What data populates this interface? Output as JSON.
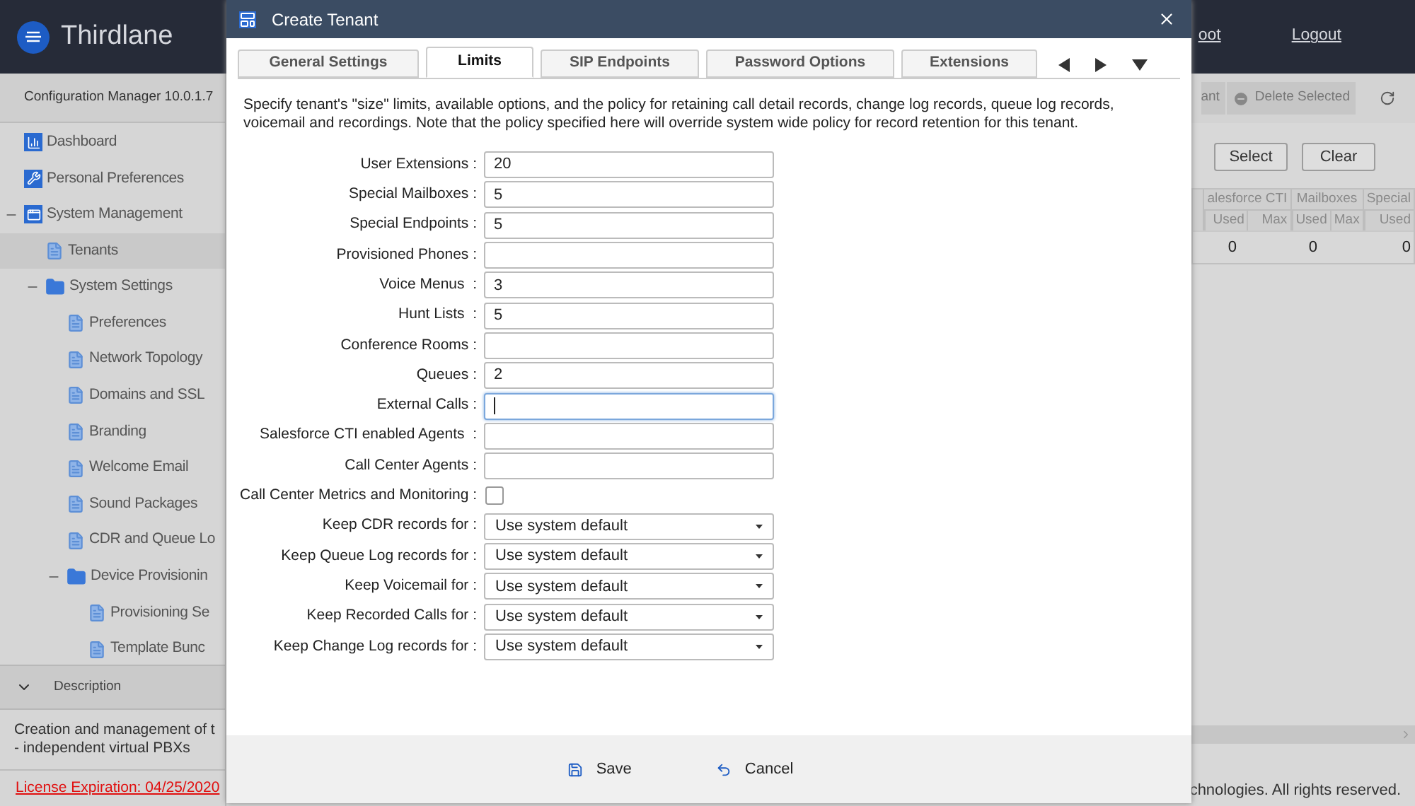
{
  "app": {
    "logo_text": "Thirdlane",
    "header_links": [
      {
        "label": "oot"
      },
      {
        "label": "Logout"
      }
    ],
    "version": "Configuration Manager 10.0.1.7"
  },
  "toolbar": {
    "buttons": [
      {
        "label": "ant",
        "kind": "plain",
        "disabled": true
      },
      {
        "label": "Delete Selected",
        "kind": "delete",
        "disabled": true
      }
    ]
  },
  "sidebar": {
    "items": [
      {
        "label": "Dashboard",
        "kind": "dashboard",
        "selected": false
      },
      {
        "label": "Personal Preferences",
        "kind": "wrench",
        "selected": false
      },
      {
        "label": "System Management",
        "kind": "section",
        "selected": false,
        "expanded": true,
        "children": [
          {
            "label": "Tenants",
            "kind": "page",
            "selected": true
          },
          {
            "label": "System Settings",
            "kind": "folder",
            "selected": false,
            "expanded": true,
            "children": [
              {
                "label": "Preferences",
                "kind": "page",
                "selected": false
              },
              {
                "label": "Network Topology",
                "kind": "page",
                "selected": false
              },
              {
                "label": "Domains and SSL",
                "kind": "page",
                "selected": false
              },
              {
                "label": "Branding",
                "kind": "page",
                "selected": false
              },
              {
                "label": "Welcome Email",
                "kind": "page",
                "selected": false
              },
              {
                "label": "Sound Packages",
                "kind": "page",
                "selected": false
              },
              {
                "label": "CDR and Queue Lo",
                "kind": "page",
                "selected": false
              },
              {
                "label": "Device Provisionin",
                "kind": "folder",
                "selected": false,
                "expanded": true,
                "children": [
                  {
                    "label": "Provisioning Se",
                    "kind": "page",
                    "selected": false
                  },
                  {
                    "label": "Template Bunc",
                    "kind": "page",
                    "selected": false
                  }
                ]
              }
            ]
          }
        ]
      }
    ]
  },
  "description": {
    "title": "Description",
    "expanded": true,
    "text": "Creation and management of t\n- independent virtual PBXs"
  },
  "license": "License Expiration: 04/25/2020",
  "filter_buttons": [
    "Select",
    "Clear"
  ],
  "table": {
    "column_groups": [
      {
        "label": "alesforce CTI",
        "sub": [
          "Used",
          "Max"
        ]
      },
      {
        "label": "Mailboxes",
        "sub": [
          "Used",
          "Max"
        ]
      },
      {
        "label": "Special",
        "sub": [
          "Used"
        ]
      }
    ],
    "rows": [
      [
        "0",
        "0",
        "0"
      ]
    ]
  },
  "footer": "chnologies. All rights reserved.",
  "dialog": {
    "title": "Create Tenant",
    "tabs": [
      {
        "label": "General Settings",
        "selected": false
      },
      {
        "label": "Limits",
        "selected": true
      },
      {
        "label": "SIP Endpoints",
        "selected": false
      },
      {
        "label": "Password Options",
        "selected": false
      },
      {
        "label": "Extensions",
        "selected": false
      }
    ],
    "intro": "Specify tenant's \"size\" limits, available options, and the policy for retaining call detail records, change log records, queue log records, voicemail and recordings. Note that the policy specified here will override system wide policy for record retention for this tenant.",
    "fields": [
      {
        "label": "User Extensions :",
        "kind": "text",
        "value": "20",
        "focused": false
      },
      {
        "label": "Special Mailboxes :",
        "kind": "text",
        "value": "5",
        "focused": false
      },
      {
        "label": "Special Endpoints :",
        "kind": "text",
        "value": "5",
        "focused": false
      },
      {
        "label": "Provisioned Phones :",
        "kind": "text",
        "focused": false
      },
      {
        "label": "Voice Menus  :",
        "kind": "text",
        "value": "3",
        "focused": false
      },
      {
        "label": "Hunt Lists  :",
        "kind": "text",
        "value": "5",
        "focused": false
      },
      {
        "label": "Conference Rooms :",
        "kind": "text",
        "focused": false
      },
      {
        "label": "Queues :",
        "kind": "text",
        "value": "2",
        "focused": false
      },
      {
        "label": "External Calls :",
        "kind": "text",
        "focused": true
      },
      {
        "label": "Salesforce CTI enabled Agents  :",
        "kind": "text",
        "focused": false
      },
      {
        "label": "Call Center Agents :",
        "kind": "text",
        "focused": false
      },
      {
        "label": "Call Center Metrics and Monitoring :",
        "kind": "checkbox",
        "checked": false
      },
      {
        "label": "Keep CDR records for :",
        "kind": "select",
        "value": "Use system default"
      },
      {
        "label": "Keep Queue Log records for :",
        "kind": "select",
        "value": "Use system default"
      },
      {
        "label": "Keep Voicemail for :",
        "kind": "select",
        "value": "Use system default"
      },
      {
        "label": "Keep Recorded Calls for :",
        "kind": "select",
        "value": "Use system default"
      },
      {
        "label": "Keep Change Log records for :",
        "kind": "select",
        "value": "Use system default"
      }
    ],
    "buttons": [
      {
        "label": "Save",
        "kind": "save"
      },
      {
        "label": "Cancel",
        "kind": "cancel"
      }
    ]
  }
}
